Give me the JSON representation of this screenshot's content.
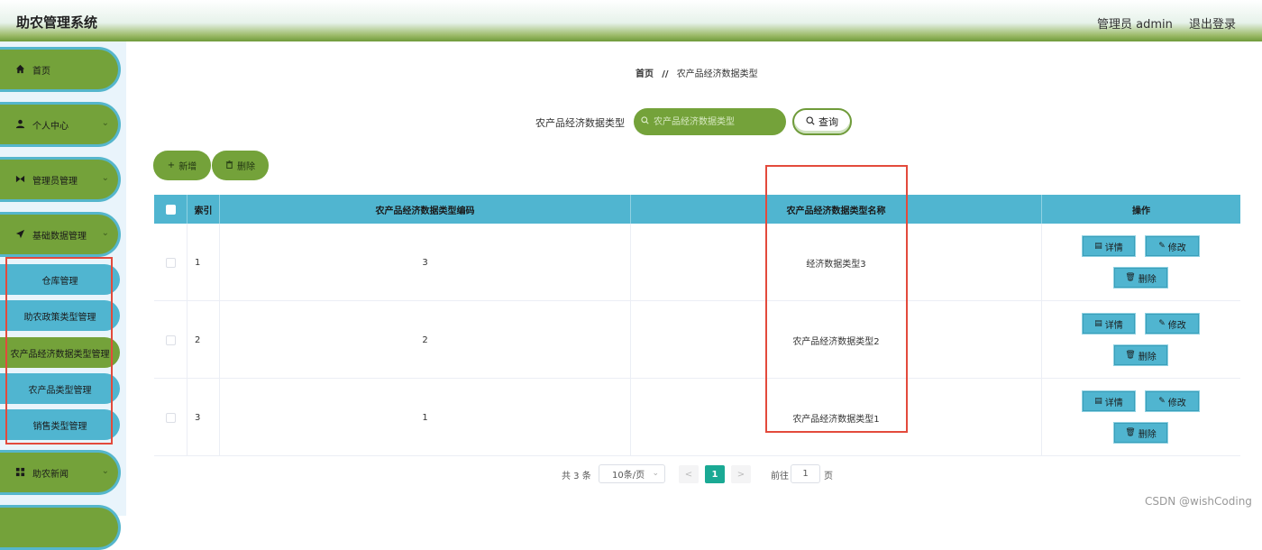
{
  "header": {
    "app_title": "助农管理系统",
    "admin": "管理员 admin",
    "logout": "退出登录"
  },
  "sidebar": {
    "items": [
      {
        "label": "首页",
        "icon": "home-icon"
      },
      {
        "label": "个人中心",
        "icon": "user-icon"
      },
      {
        "label": "管理员管理",
        "icon": "admin-icon"
      },
      {
        "label": "基础数据管理",
        "icon": "send-icon"
      },
      {
        "label": "助农新闻",
        "icon": "grid-icon"
      }
    ],
    "submenu": [
      "仓库管理",
      "助农政策类型管理",
      "农产品经济数据类型管理",
      "农产品类型管理",
      "销售类型管理"
    ]
  },
  "breadcrumb": {
    "home": "首页",
    "sep": "//",
    "current": "农产品经济数据类型"
  },
  "search": {
    "label": "农产品经济数据类型",
    "placeholder": "农产品经济数据类型",
    "button": "查询"
  },
  "actions": {
    "add": "新增",
    "delete": "删除"
  },
  "table": {
    "columns": [
      "索引",
      "农产品经济数据类型编码",
      "农产品经济数据类型名称",
      "操作"
    ],
    "rows": [
      {
        "index": "1",
        "code": "3",
        "name": "经济数据类型3"
      },
      {
        "index": "2",
        "code": "2",
        "name": "农产品经济数据类型2"
      },
      {
        "index": "3",
        "code": "1",
        "name": "农产品经济数据类型1"
      }
    ],
    "ops": {
      "detail": "详情",
      "edit": "修改",
      "delete": "删除"
    }
  },
  "pagination": {
    "total": "共 3 条",
    "page_size": "10条/页",
    "prev": "<",
    "next": ">",
    "current": "1",
    "goto_label": "前往",
    "goto_value": "1",
    "goto_suffix": "页"
  },
  "watermark": "CSDN @wishCoding",
  "colors": {
    "green": "#74a23a",
    "blue": "#50b5d0",
    "page_active": "#1aa994",
    "highlight": "#e34a3c"
  }
}
